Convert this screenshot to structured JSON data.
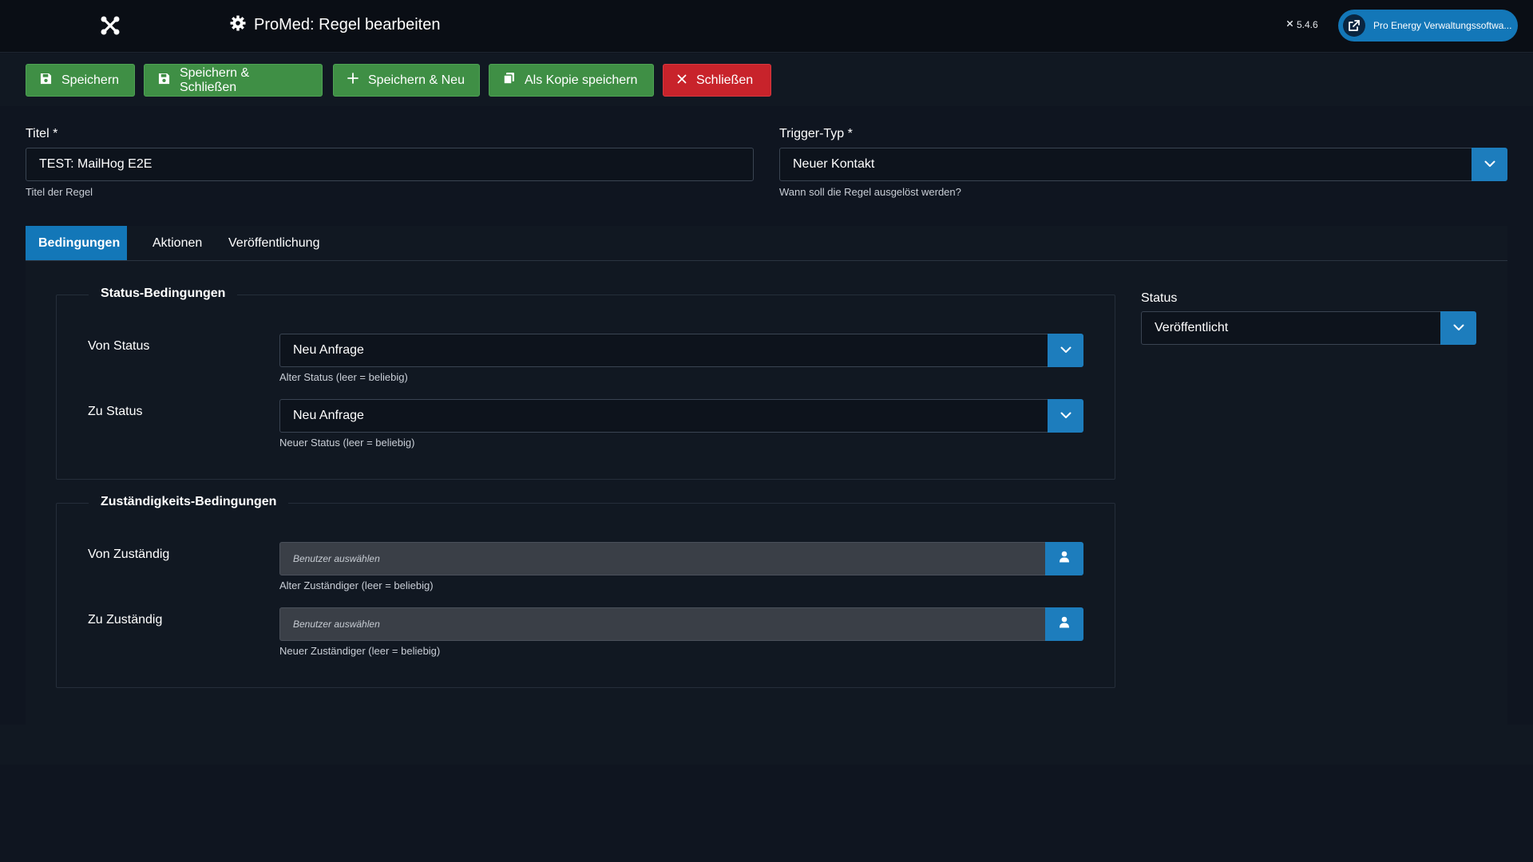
{
  "header": {
    "title": "ProMed: Regel bearbeiten",
    "version": "5.4.6",
    "site_button_label": "Pro Energy Verwaltungssoftwa..."
  },
  "toolbar": {
    "save": "Speichern",
    "save_close": "Speichern & Schließen",
    "save_new": "Speichern & Neu",
    "save_copy": "Als Kopie speichern",
    "close": "Schließen"
  },
  "form": {
    "title_label": "Titel *",
    "title_value": "TEST: MailHog E2E",
    "title_help": "Titel der Regel",
    "trigger_label": "Trigger-Typ *",
    "trigger_value": "Neuer Kontakt",
    "trigger_help": "Wann soll die Regel ausgelöst werden?"
  },
  "tabs": [
    {
      "label": "Bedingungen",
      "active": true
    },
    {
      "label": "Aktionen",
      "active": false
    },
    {
      "label": "Veröffentlichung",
      "active": false
    }
  ],
  "status_conditions": {
    "legend": "Status-Bedingungen",
    "from_label": "Von Status",
    "from_value": "Neu Anfrage",
    "from_help": "Alter Status (leer = beliebig)",
    "to_label": "Zu Status",
    "to_value": "Neu Anfrage",
    "to_help": "Neuer Status (leer = beliebig)"
  },
  "assignee_conditions": {
    "legend": "Zuständigkeits-Bedingungen",
    "from_label": "Von Zuständig",
    "from_placeholder": "Benutzer auswählen",
    "from_help": "Alter Zuständiger (leer = beliebig)",
    "to_label": "Zu Zuständig",
    "to_placeholder": "Benutzer auswählen",
    "to_help": "Neuer Zuständiger (leer = beliebig)"
  },
  "sidebar": {
    "status_label": "Status",
    "status_value": "Veröffentlicht"
  },
  "colors": {
    "primary": "#1377b8",
    "success": "#3f8f45",
    "danger": "#c8232b",
    "background": "#0f1520"
  }
}
